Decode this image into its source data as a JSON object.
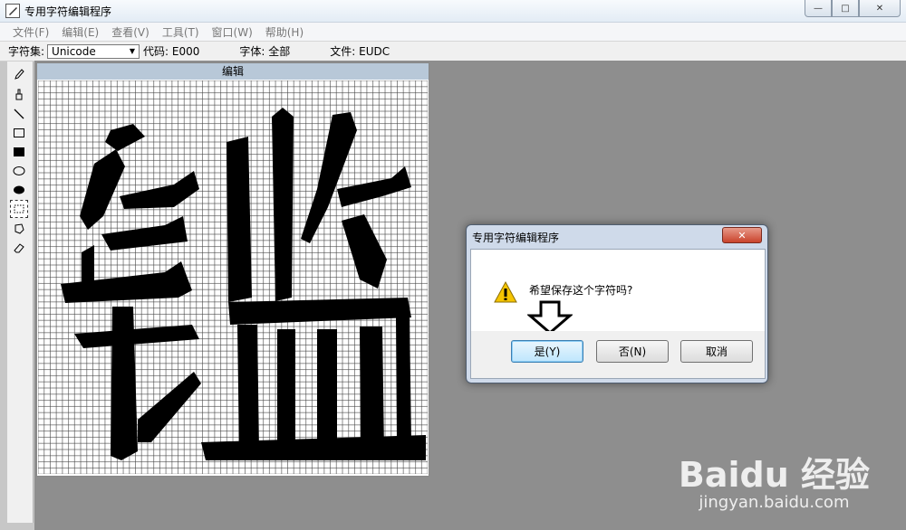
{
  "window": {
    "title": "专用字符编辑程序",
    "buttons": {
      "minimize": "—",
      "maximize": "□",
      "close": "✕"
    }
  },
  "menu": [
    "文件(F)",
    "编辑(E)",
    "查看(V)",
    "工具(T)",
    "窗口(W)",
    "帮助(H)"
  ],
  "infobar": {
    "charset_label": "字符集:",
    "charset_value": "Unicode",
    "code": "代码: E000",
    "font": "字体: 全部",
    "file": "文件: EUDC"
  },
  "editor": {
    "title": "编辑",
    "grid_size": 64,
    "glyph": "鑑"
  },
  "tools": [
    "pencil-icon",
    "brush-icon",
    "line-icon",
    "hollow-rect-icon",
    "filled-rect-icon",
    "hollow-ellipse-icon",
    "filled-ellipse-icon",
    "rect-select-icon",
    "freeform-select-icon",
    "eraser-icon"
  ],
  "dialog": {
    "title": "专用字符编辑程序",
    "message": "希望保存这个字符吗?",
    "yes": "是(Y)",
    "no": "否(N)",
    "cancel": "取消"
  },
  "watermark": {
    "logo": "Baidu 经验",
    "url": "jingyan.baidu.com"
  }
}
